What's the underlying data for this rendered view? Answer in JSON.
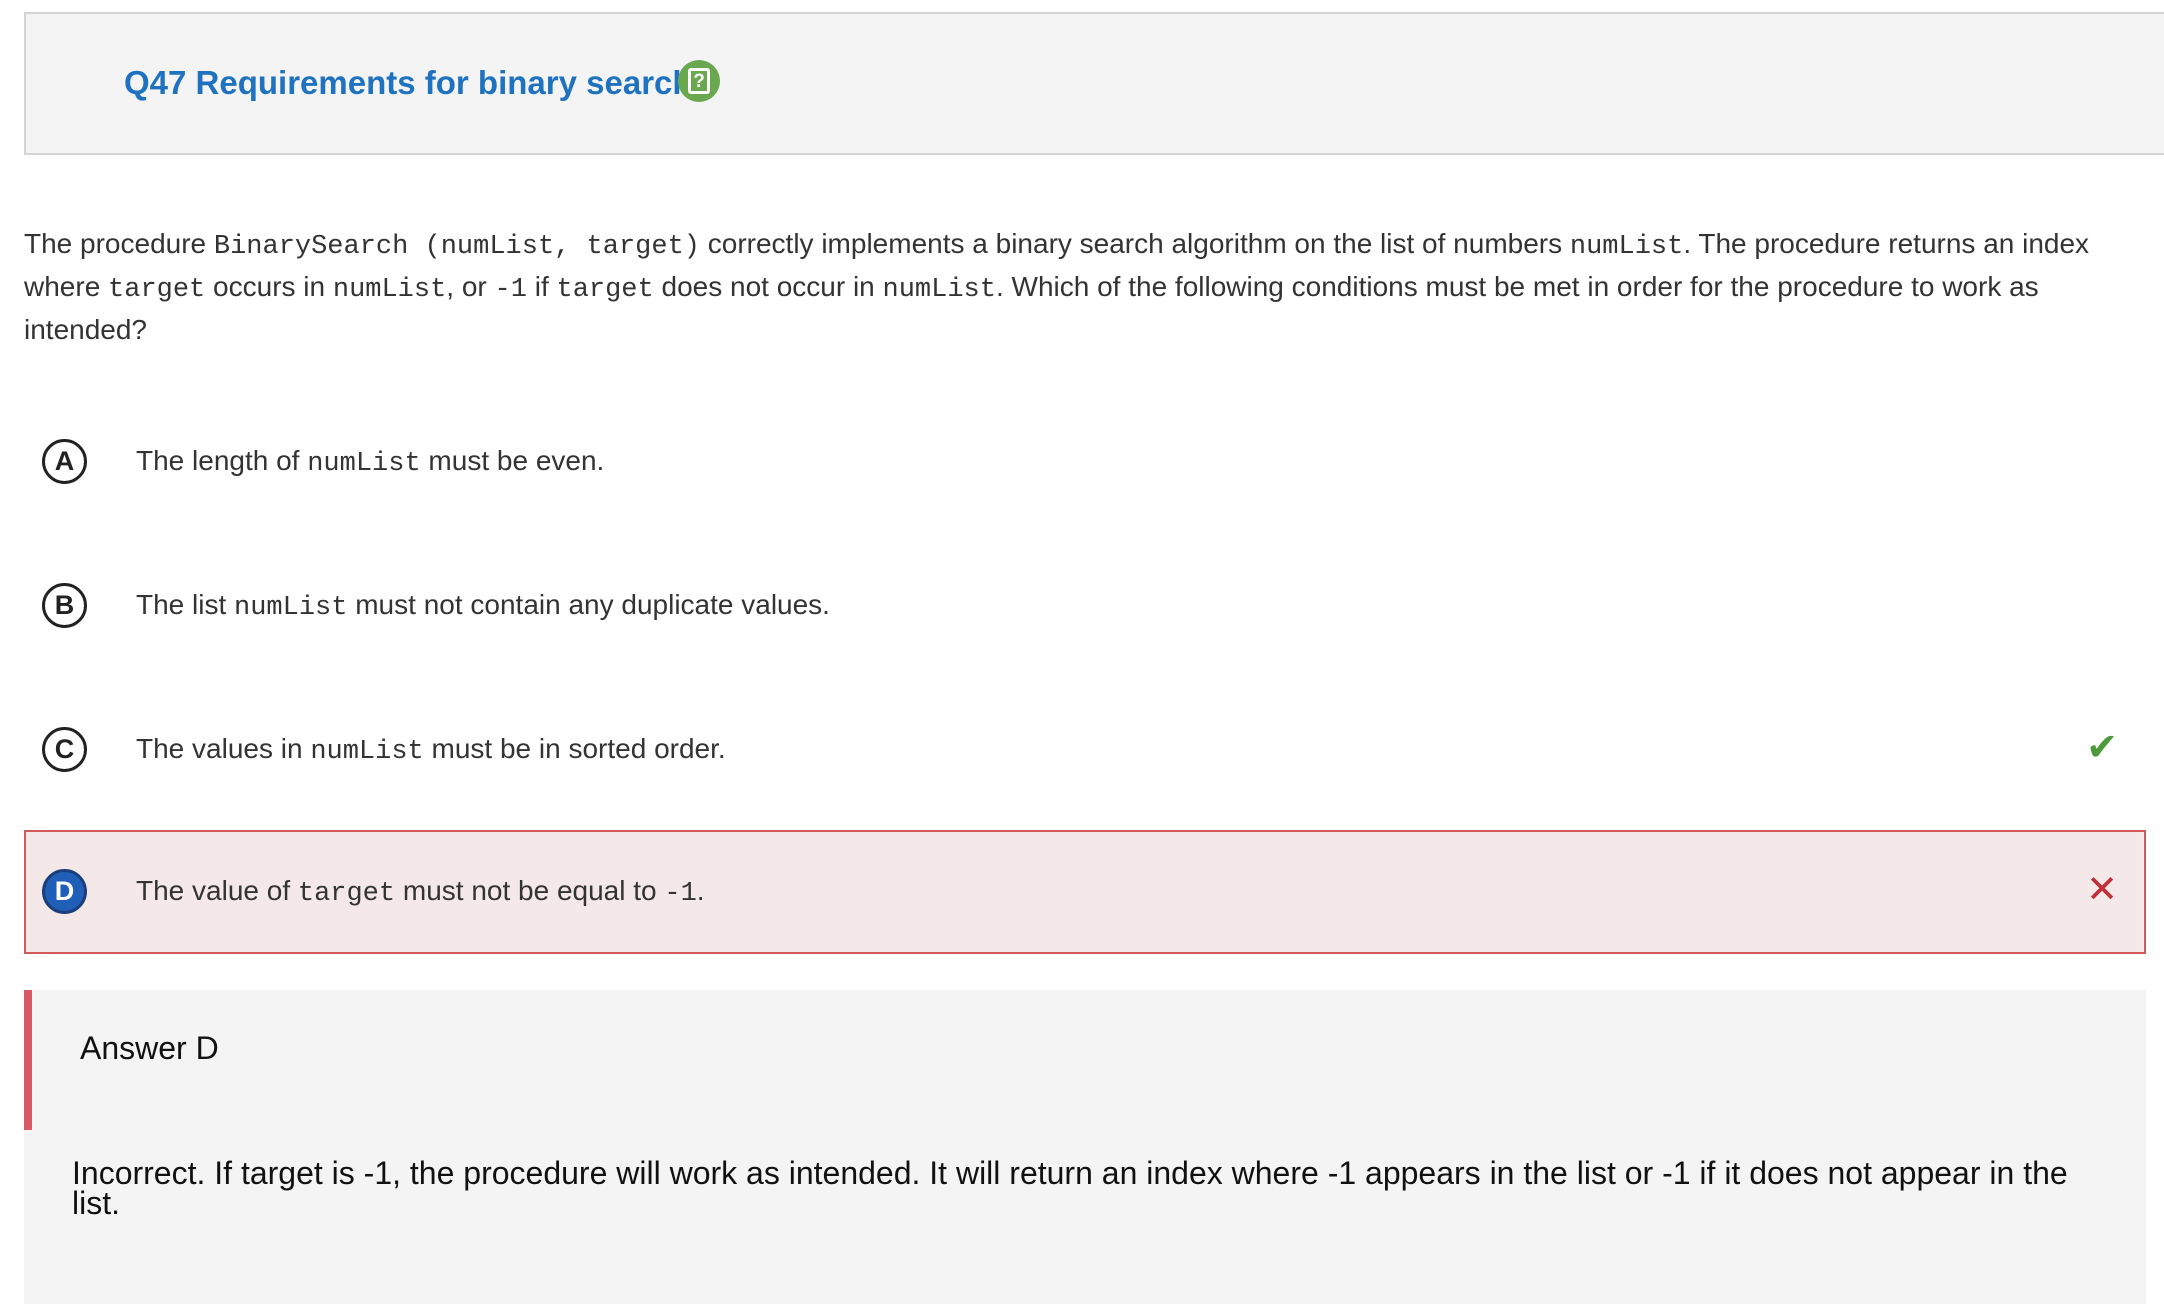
{
  "question": {
    "title": "Q47 Requirements for binary search",
    "help_icon": "help-note-icon",
    "stem": {
      "p1": "The procedure ",
      "code1": "BinarySearch (numList, target)",
      "p2": " correctly implements a binary search algorithm on the list of numbers ",
      "code2": "numList",
      "p3": ". The procedure returns an index where ",
      "code3": "target",
      "p4": " occurs in ",
      "code4": "numList",
      "p5": ", or ",
      "code5": "-1",
      "p6": " if ",
      "code6": "target",
      "p7": " does not occur in ",
      "code7": "numList",
      "p8": ". Which of the following conditions must be met in order for the procedure to work as intended?"
    }
  },
  "options": [
    {
      "letter": "A",
      "t1": "The length of ",
      "c1": "numList",
      "t2": " must be even.",
      "selected": false,
      "mark": ""
    },
    {
      "letter": "B",
      "t1": "The list ",
      "c1": "numList",
      "t2": " must not contain any duplicate values.",
      "selected": false,
      "mark": ""
    },
    {
      "letter": "C",
      "t1": "The values in ",
      "c1": "numList",
      "t2": " must be in sorted order.",
      "selected": false,
      "mark": "✔"
    },
    {
      "letter": "D",
      "t1": "The value of ",
      "c1": "target",
      "t2": " must not be equal to ",
      "c2": "-1",
      "t3": ".",
      "selected": true,
      "mark": "✕"
    }
  ],
  "answer": {
    "heading": "Answer D",
    "explanation": "Incorrect. If target is -1, the procedure will work as intended. It will return an index where -1 appears in the list or -1 if it does not appear in the list."
  },
  "colors": {
    "title": "#1f72bf",
    "correct": "#4c9a3a",
    "wrong": "#c0303a",
    "selected_bg": "#f5e8e8",
    "selected_letter": "#1f5fb8"
  }
}
